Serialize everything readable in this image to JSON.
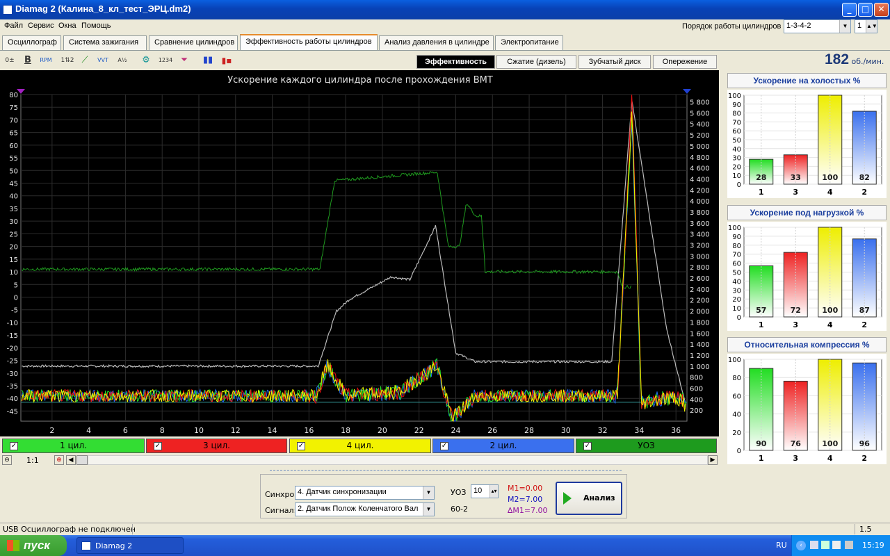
{
  "window": {
    "title": "Diamag 2 (Калина_8_кл_тест_ЭРЦ.dm2)",
    "minimize": "_",
    "maximize": "□",
    "close": "✕"
  },
  "menu": [
    "Файл",
    "Сервис",
    "Окна",
    "Помощь"
  ],
  "firing_order": {
    "label": "Порядок работы цилиндров",
    "value": "1-3-4-2",
    "cylinder": "1"
  },
  "tabs": [
    "Осциллограф",
    "Система зажигания",
    "Сравнение цилиндров",
    "Эффективность работы цилиндров",
    "Анализ давления в цилиндре",
    "Электропитание"
  ],
  "active_tab": 3,
  "toolbar_icons": [
    "settings-icon",
    "bold-icon",
    "rpm-icon",
    "scale-icon",
    "line-icon",
    "vvt-icon",
    "algorithm-icon",
    "filter-icon",
    "sort-icon",
    "funnel-icon",
    "bars-icon",
    "marker-icon"
  ],
  "subtabs": [
    "Эффективность",
    "Сжатие (дизель)",
    "Зубчатый диск",
    "Опережение"
  ],
  "rpm": {
    "value": "182",
    "unit": "об./мин."
  },
  "chart_data": {
    "type": "line",
    "title": "Ускорение каждого цилиндра после прохождения ВМТ",
    "xticks": [
      "2",
      "4",
      "6",
      "8",
      "10",
      "12",
      "14",
      "16",
      "18",
      "20",
      "22",
      "24",
      "26",
      "28",
      "30",
      "32",
      "34",
      "36"
    ],
    "ylim": [
      -49,
      80
    ],
    "yticks": [
      "80",
      "75",
      "70",
      "65",
      "60",
      "55",
      "50",
      "45",
      "40",
      "35",
      "30",
      "25",
      "20",
      "15",
      "10",
      "5",
      "0",
      "-5",
      "-10",
      "-15",
      "-20",
      "-25",
      "-30",
      "-35",
      "-40",
      "-45"
    ],
    "y2lim": [
      0,
      5933
    ],
    "y2ticks": [
      "5 800",
      "5 600",
      "5 400",
      "5 200",
      "5 000",
      "4 800",
      "4 600",
      "4 400",
      "4 200",
      "4 000",
      "3 800",
      "3 600",
      "3 400",
      "3 200",
      "3 000",
      "2 800",
      "2 600",
      "2 400",
      "2 200",
      "2 000",
      "1 800",
      "1 600",
      "1 400",
      "1 200",
      "1 000",
      "800",
      "600",
      "400",
      "200"
    ],
    "series": [
      {
        "name": "1 цил.",
        "color": "#22dd22"
      },
      {
        "name": "3 цил.",
        "color": "#ee1111"
      },
      {
        "name": "4 цил.",
        "color": "#eeee00"
      },
      {
        "name": "2 цил.",
        "color": "#2266ee"
      },
      {
        "name": "УОЗ",
        "color": "#1f9a1f"
      }
    ],
    "rpm_trace_color": "#bbbbbb"
  },
  "channels": [
    {
      "label": "1 цил.",
      "color": "#33dd33"
    },
    {
      "label": "3 цил.",
      "color": "#ee2222"
    },
    {
      "label": "4 цил.",
      "color": "#f2f200"
    },
    {
      "label": "2 цил.",
      "color": "#3a70ee"
    },
    {
      "label": "УОЗ",
      "color": "#1e9b1e"
    }
  ],
  "zoom": "1:1",
  "bar_charts": [
    {
      "title": "Ускорение на холостых %",
      "yticks": [
        "100",
        "90",
        "80",
        "70",
        "60",
        "50",
        "40",
        "30",
        "20",
        "10",
        "0"
      ],
      "ymax": 100,
      "categories": [
        "1",
        "3",
        "4",
        "2"
      ],
      "values": [
        28,
        33,
        100,
        82
      ],
      "colors": [
        "#22dd22",
        "#ee2222",
        "#eeee00",
        "#3a70ee"
      ]
    },
    {
      "title": "Ускорение под нагрузкой %",
      "yticks": [
        "100",
        "90",
        "80",
        "70",
        "60",
        "50",
        "40",
        "30",
        "20",
        "10",
        "0"
      ],
      "ymax": 100,
      "categories": [
        "1",
        "3",
        "4",
        "2"
      ],
      "values": [
        57,
        72,
        100,
        87
      ],
      "colors": [
        "#22dd22",
        "#ee2222",
        "#eeee00",
        "#3a70ee"
      ]
    },
    {
      "title": "Относительная компрессия %",
      "yticks": [
        "100",
        "80",
        "60",
        "40",
        "20",
        "0"
      ],
      "ymax": 100,
      "categories": [
        "1",
        "3",
        "4",
        "2"
      ],
      "values": [
        90,
        76,
        100,
        96
      ],
      "colors": [
        "#22dd22",
        "#ee2222",
        "#eeee00",
        "#3a70ee"
      ]
    }
  ],
  "bottom": {
    "sync_label": "Синхро:",
    "sync_value": "4.  Датчик синхронизации",
    "signal_label": "Сигнал:",
    "signal_value": "2.  Датчик Полож Коленчатого Вал",
    "uoz_label": "УОЗ",
    "uoz_value": "10",
    "teeth": "60-2",
    "m1": "M1=0.00",
    "m2": "M2=7.00",
    "dm": "∆M1=7.00",
    "analyze": "Анализ"
  },
  "status": {
    "text": "USB Осциллограф не подключен",
    "right": "1.5"
  },
  "taskbar": {
    "start": "пуск",
    "app": "Diamag 2",
    "lang": "RU",
    "clock": "15:19"
  }
}
